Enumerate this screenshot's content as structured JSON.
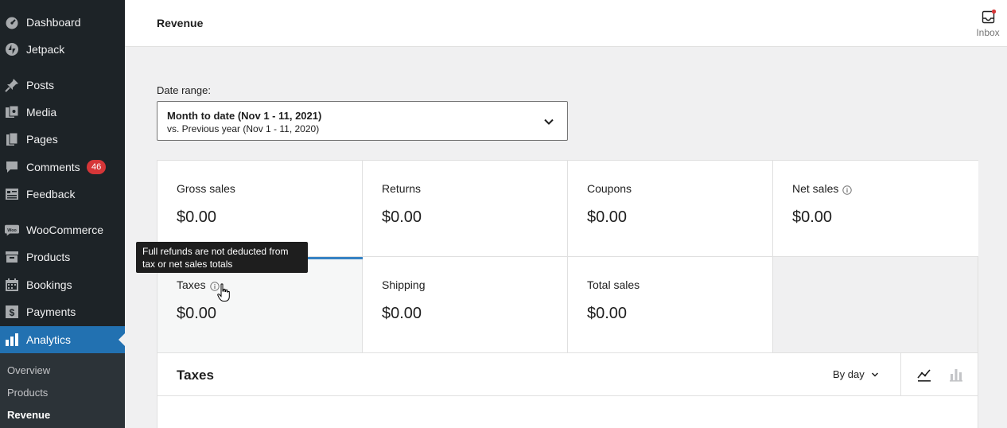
{
  "sidebar": {
    "items": [
      {
        "label": "Dashboard",
        "icon": "dashboard-icon"
      },
      {
        "label": "Jetpack",
        "icon": "jetpack-icon"
      },
      {
        "label": "Posts",
        "icon": "pin-icon"
      },
      {
        "label": "Media",
        "icon": "media-icon"
      },
      {
        "label": "Pages",
        "icon": "pages-icon"
      },
      {
        "label": "Comments",
        "icon": "comment-icon",
        "badge": "46"
      },
      {
        "label": "Feedback",
        "icon": "feedback-icon"
      },
      {
        "label": "WooCommerce",
        "icon": "woocommerce-icon"
      },
      {
        "label": "Products",
        "icon": "archive-icon"
      },
      {
        "label": "Bookings",
        "icon": "calendar-icon"
      },
      {
        "label": "Payments",
        "icon": "dollar-icon"
      },
      {
        "label": "Analytics",
        "icon": "bar-chart-icon",
        "active": true
      }
    ],
    "submenu": [
      {
        "label": "Overview"
      },
      {
        "label": "Products"
      },
      {
        "label": "Revenue",
        "current": true
      }
    ]
  },
  "header": {
    "title": "Revenue",
    "inbox_label": "Inbox"
  },
  "date_range": {
    "label": "Date range:",
    "primary": "Month to date (Nov 1 - 11, 2021)",
    "secondary": "vs. Previous year (Nov 1 - 11, 2020)"
  },
  "summary": [
    {
      "label": "Gross sales",
      "value": "$0.00"
    },
    {
      "label": "Returns",
      "value": "$0.00"
    },
    {
      "label": "Coupons",
      "value": "$0.00"
    },
    {
      "label": "Net sales",
      "value": "$0.00",
      "info": true
    },
    {
      "label": "Taxes",
      "value": "$0.00",
      "info": true,
      "selected": true
    },
    {
      "label": "Shipping",
      "value": "$0.00"
    },
    {
      "label": "Total sales",
      "value": "$0.00"
    }
  ],
  "tooltip": {
    "text": "Full refunds are not deducted from tax or net sales totals"
  },
  "chart": {
    "title": "Taxes",
    "interval": "By day"
  },
  "colors": {
    "sidebar_bg": "#1d2327",
    "accent": "#2271b1",
    "badge": "#d63638",
    "selected_bar": "#3582c4"
  }
}
